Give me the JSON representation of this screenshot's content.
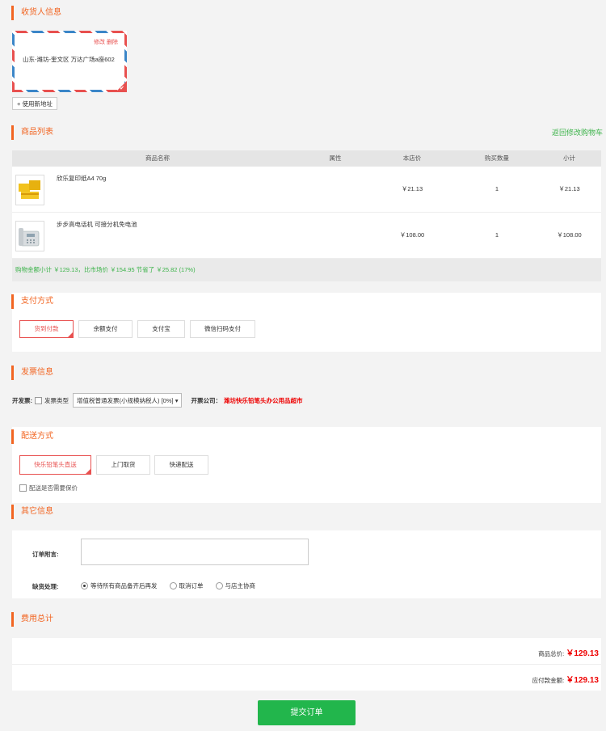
{
  "sections": {
    "receiver": "收货人信息",
    "goods": "商品列表",
    "payment": "支付方式",
    "invoice": "发票信息",
    "delivery": "配送方式",
    "other": "其它信息",
    "fees": "费用总计"
  },
  "address": {
    "ops": "修改 删除",
    "text": "山东-潍坊-奎文区 万达广场a座602"
  },
  "new_address_label": "+ 使用新地址",
  "back_to_cart": "返回修改购物车",
  "table": {
    "headers": [
      "商品名称",
      "属性",
      "本店价",
      "购买数量",
      "小计"
    ],
    "rows": [
      {
        "name": "欣乐复印纸A4 70g",
        "attr": "",
        "price": "￥21.13",
        "qty": "1",
        "subtotal": "￥21.13",
        "thumb_icon": "copy-paper-icon"
      },
      {
        "name": "步步高电话机 可接分机免电池",
        "attr": "",
        "price": "￥108.00",
        "qty": "1",
        "subtotal": "￥108.00",
        "thumb_icon": "telephone-icon"
      }
    ],
    "summary": "购物金额小计 ￥129.13，比市场价 ￥154.95 节省了 ￥25.82 (17%)"
  },
  "payment_options": [
    "货到付款",
    "余额支付",
    "支付宝",
    "微信扫码支付"
  ],
  "invoice": {
    "open_label": "开发票:",
    "type_label": "发票类型",
    "type_value": "增值税普通发票(小规模纳税人) [0%]",
    "company_label": "开票公司：",
    "company_value": "潍坊快乐铅笔头办公用品超市"
  },
  "delivery_options": [
    "快乐铅笔头直送",
    "上门取货",
    "快递配送"
  ],
  "insure_label": "配送是否需要保价",
  "other": {
    "note_label": "订单附言:",
    "note_value": "",
    "shortage_label": "缺货处理:",
    "shortage_options": [
      "等待所有商品备齐后再发",
      "取消订单",
      "与店主协商"
    ]
  },
  "fees": {
    "goods_total_label": "商品总价:",
    "goods_total": "￥129.13",
    "payable_label": "应付款金额:",
    "payable": "￥129.13"
  },
  "submit_label": "提交订单",
  "colors": {
    "accent": "#f26522",
    "green": "#22b64c",
    "red": "#e8504f"
  }
}
